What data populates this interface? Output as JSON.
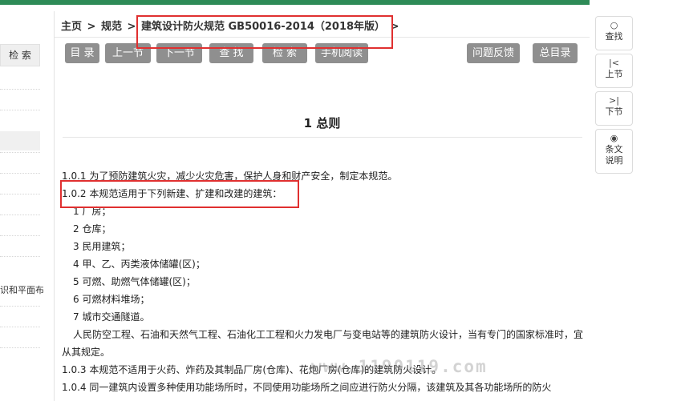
{
  "sidebar": {
    "search_button": "检 索",
    "partial_text": "识和平面布"
  },
  "breadcrumb": [
    "主页",
    ">",
    "规范",
    ">",
    "建筑设计防火规范 GB50016-2014（2018年版）",
    ">"
  ],
  "toolbar": {
    "mulu": "目 录",
    "prev": "上一节",
    "next": "下一节",
    "find": "查 找",
    "search": "检 索",
    "mobile": "手机阅读",
    "feedback": "问题反馈",
    "catalog": "总目录"
  },
  "section_title": "1 总则",
  "content": {
    "p1": "1.0.1 为了预防建筑火灾，减少火灾危害，保护人身和财产安全，制定本规范。",
    "p2": "1.0.2 本规范适用于下列新建、扩建和改建的建筑：",
    "items": [
      "1 厂房；",
      "2 仓库；",
      "3 民用建筑；",
      "4 甲、乙、丙类液体储罐(区)；",
      "5 可燃、助燃气体储罐(区)；",
      "6 可燃材料堆场；",
      "7 城市交通隧道。"
    ],
    "note": "人民防空工程、石油和天然气工程、石油化工工程和火力发电厂与变电站等的建筑防火设计，当有专门的国家标准时，宜从其规定。",
    "p3": "1.0.3 本规范不适用于火药、炸药及其制品厂房(仓库)、花炮厂房(仓库)的建筑防火设计。",
    "p4": "1.0.4 同一建筑内设置多种使用功能场所时，不同使用功能场所之间应进行防火分隔，该建筑及其各功能场所的防火"
  },
  "watermark": "www.1190119.com",
  "tools": {
    "search": "查找",
    "prev": "上节",
    "next": "下节",
    "explain_1": "条文",
    "explain_2": "说明",
    "search_icon": "magnifier",
    "prev_icon": "first-page",
    "next_icon": "last-page",
    "explain_icon": "eye"
  },
  "colors": {
    "accent_bar": "#2e8b57",
    "button_gray": "#8f8f8f",
    "highlight_red": "#e03030"
  }
}
